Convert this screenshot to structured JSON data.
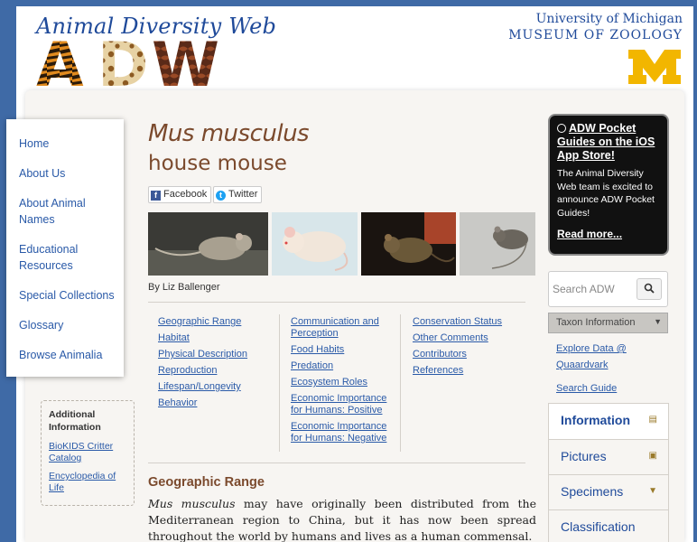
{
  "header": {
    "site_title": "Animal Diversity Web",
    "logo_letters": [
      "A",
      "D",
      "W"
    ],
    "university_line1": "University of Michigan",
    "university_line2": "MUSEUM OF ZOOLOGY",
    "m_logo": "M"
  },
  "nav": {
    "items": [
      {
        "label": "Home"
      },
      {
        "label": "About Us"
      },
      {
        "label": "About Animal Names"
      },
      {
        "label": "Educational Resources"
      },
      {
        "label": "Special Collections"
      },
      {
        "label": "Glossary"
      },
      {
        "label": "Browse Animalia"
      }
    ]
  },
  "additional_info": {
    "title": "Additional Information",
    "links": [
      "BioKIDS Critter Catalog",
      "Encyclopedia of Life"
    ]
  },
  "species": {
    "scientific_name": "Mus musculus",
    "common_name": "house mouse",
    "byline": "By Liz Ballenger"
  },
  "share": {
    "facebook": "Facebook",
    "twitter": "Twitter",
    "facebook_icon": "facebook-icon",
    "twitter_icon": "twitter-icon"
  },
  "toc": {
    "col1": [
      "Geographic Range",
      "Habitat",
      "Physical Description",
      "Reproduction",
      "Lifespan/Longevity",
      "Behavior"
    ],
    "col2": [
      "Communication and Perception",
      "Food Habits",
      "Predation",
      "Ecosystem Roles",
      "Economic Importance for Humans: Positive",
      "Economic Importance for Humans: Negative"
    ],
    "col3": [
      "Conservation Status",
      "Other Comments",
      "Contributors",
      "References"
    ]
  },
  "section": {
    "title": "Geographic Range",
    "body_italic": "Mus musculus",
    "body_rest": " may have originally been distributed from the Mediterranean region to China, but it has now been spread throughout the world by humans and lives as a human commensal."
  },
  "promo": {
    "title": "ADW Pocket Guides on the iOS App Store!",
    "text": "The Animal Diversity Web team is excited to announce ADW Pocket Guides!",
    "more": "Read more..."
  },
  "search": {
    "placeholder": "Search ADW",
    "button_icon": "search-icon"
  },
  "taxon": {
    "label": "Taxon Information"
  },
  "right_links": [
    "Explore Data @ Quaardvark",
    "Search Guide"
  ],
  "right_tabs": [
    {
      "label": "Information",
      "icon": "document-icon"
    },
    {
      "label": "Pictures",
      "icon": "camera-icon"
    },
    {
      "label": "Specimens",
      "icon": "specimen-icon"
    },
    {
      "label": "Classification",
      "icon": ""
    }
  ],
  "colors": {
    "brand_blue": "#1f4a9a",
    "background_blue": "#3f6aa6",
    "heading_brown": "#7b4a2d",
    "link_blue": "#2a5aa8",
    "maize": "#f2b600"
  }
}
